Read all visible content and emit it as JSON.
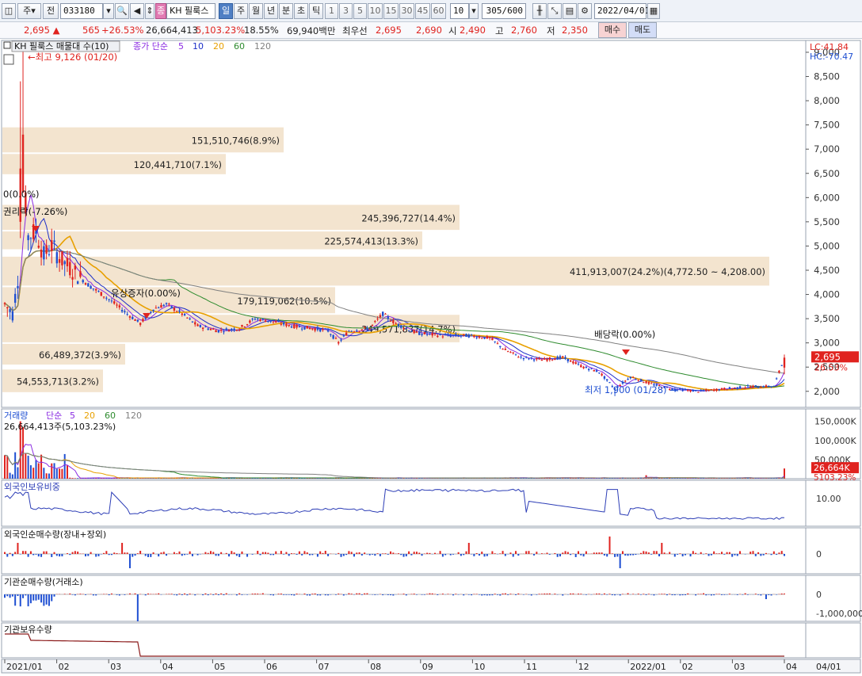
{
  "toolbar": {
    "period_select": "주",
    "prev_btn": "전",
    "stock_code": "033180",
    "stock_name_badge": "종",
    "stock_name": "KH 필룩스",
    "periods": [
      "일",
      "주",
      "월",
      "년",
      "분",
      "초",
      "틱"
    ],
    "active_period": "일",
    "minutes": [
      "1",
      "3",
      "5",
      "10",
      "15",
      "30",
      "45",
      "60"
    ],
    "minute_input": "10",
    "count": "305",
    "count_total": "/600",
    "date": "2022/04/01"
  },
  "quote": {
    "price": "2,695",
    "change": "565",
    "change_pct": "+26.53%",
    "volume": "26,664,413",
    "volume_pct": "5,103.23%",
    "turnover": "18.55%",
    "amount": "69,940백만",
    "best_bid_label": "최우선",
    "best_ask": "2,695",
    "best_bid": "2,690",
    "open_label": "시",
    "open": "2,490",
    "high_label": "고",
    "high": "2,760",
    "low_label": "저",
    "low": "2,350",
    "buy_label": "매수",
    "sell_label": "매도"
  },
  "colors": {
    "up": "#e0231f",
    "down": "#1f4fd2",
    "ma5": "#8a2be2",
    "ma10": "#1c2fc8",
    "ma20": "#e8a000",
    "ma60": "#2e8b2e",
    "ma120": "#808080",
    "volume_profile": "#f3e4cf"
  },
  "price_panel": {
    "header": "KH 필룩스 매물대 수(10)",
    "ma_label": "종가 단순",
    "ma_periods": [
      "5",
      "10",
      "20",
      "60",
      "120"
    ],
    "lc": "LC:41.84",
    "hc": "HC:-70.47",
    "y_ticks": [
      "9,000",
      "8,500",
      "8,000",
      "7,500",
      "7,000",
      "6,500",
      "6,000",
      "5,500",
      "5,000",
      "4,500",
      "4,000",
      "3,500",
      "3,000",
      "2,500",
      "2,000"
    ],
    "current_price_tag": "2,695",
    "current_pct_tag": "26.53%",
    "high_note": "최고 9,126 (01/20)",
    "low_note": "최저 1,900 (01/28)",
    "events": [
      "0(0.0%)",
      "권리락(-7.26%)",
      "유상증자(0.00%)",
      "배당락(0.00%)"
    ],
    "profile_labels": [
      "151,510,746(8.9%)",
      "120,441,710(7.1%)",
      "245,396,727(14.4%)",
      "225,574,413(13.3%)",
      "411,913,007(24.2%)(4,772.50 ~ 4,208.00)",
      "179,119,062(10.5%)",
      "249,571,837(14.7%)",
      "66,489,372(3.9%)",
      "54,553,713(3.2%)"
    ]
  },
  "volume_panel": {
    "header": "거래량",
    "ma_label": "단순",
    "ma_periods": [
      "5",
      "20",
      "60",
      "120"
    ],
    "value_note": "26,664,413주(5,103.23%)",
    "y_ticks": [
      "150,000K",
      "100,000K",
      "50,000K"
    ],
    "current_tag": "26,664K",
    "current_pct_tag": "5103.23%"
  },
  "foreign_ratio_panel": {
    "header": "외국인보유비중",
    "y_ticks": [
      "10.00"
    ]
  },
  "foreign_net_panel": {
    "header": "외국인순매수량(장내+장외)",
    "y_ticks": [
      "0"
    ]
  },
  "inst_net_panel": {
    "header": "기관순매수량(거래소)",
    "y_ticks": [
      "0",
      "-1,000,000"
    ]
  },
  "inst_hold_panel": {
    "header": "기관보유수량"
  },
  "x_axis": {
    "labels": [
      "2021/01",
      "02",
      "03",
      "04",
      "05",
      "06",
      "07",
      "08",
      "09",
      "10",
      "11",
      "12",
      "2022/01",
      "02",
      "03",
      "04"
    ],
    "right_label": "04/01"
  },
  "chart_data": [
    {
      "type": "candlestick",
      "title": "KH 필룩스",
      "xlabel": "",
      "ylabel": "",
      "x": [
        "2021/01",
        "2021/02",
        "2021/03",
        "2021/04",
        "2021/05",
        "2021/06",
        "2021/07",
        "2021/08",
        "2021/09",
        "2021/10",
        "2021/11",
        "2021/12",
        "2022/01",
        "2022/02",
        "2022/03",
        "2022/04"
      ],
      "close_approx": [
        5500,
        5000,
        4000,
        3500,
        3400,
        3250,
        3450,
        3250,
        3500,
        3200,
        3100,
        2750,
        2550,
        2150,
        2050,
        2695
      ],
      "ylim": [
        1800,
        9300
      ],
      "y_scale": "linear",
      "grid": false,
      "legend": "top-left"
    },
    {
      "type": "bar",
      "title": "거래량",
      "xlabel": "",
      "ylabel": "",
      "x": [
        "2021/01",
        "2021/02",
        "2021/03",
        "2021/04",
        "2021/05",
        "2021/06",
        "2021/07",
        "2021/08",
        "2021/09",
        "2021/10",
        "2021/11",
        "2021/12",
        "2022/01",
        "2022/02",
        "2022/03",
        "2022/04"
      ],
      "values_K": [
        150000,
        35000,
        9000,
        6000,
        4000,
        3000,
        3500,
        3000,
        4000,
        2500,
        2000,
        3000,
        4000,
        9000,
        3000,
        26664
      ],
      "ylim": [
        0,
        170000
      ],
      "grid": false
    }
  ]
}
